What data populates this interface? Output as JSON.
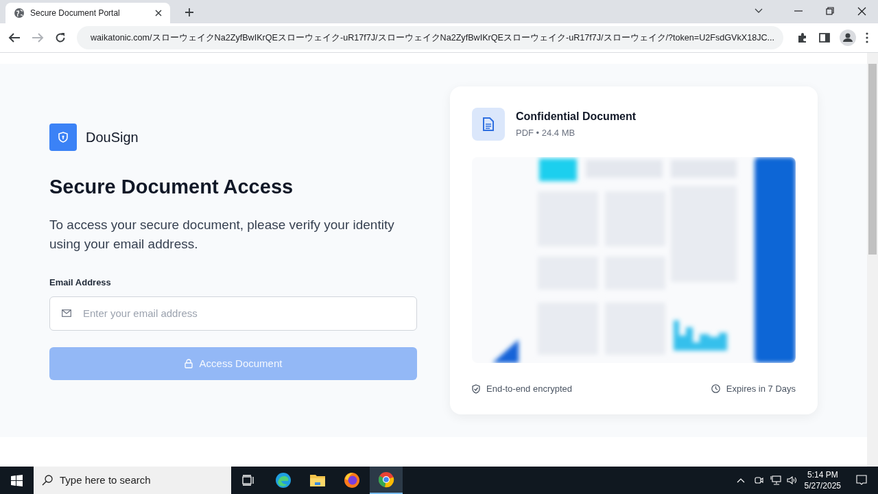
{
  "browser": {
    "tab_title": "Secure Document Portal",
    "url": "waikatonic.com/スローウェイクNa2ZyfBwIKrQEスローウェイク-uR17f7J/スローウェイクNa2ZyfBwIKrQEスローウェイク-uR17f7J/スローウェイク/?token=U2FsdGVkX18JC..."
  },
  "brand": {
    "name": "DouSign"
  },
  "heading": "Secure Document Access",
  "description": "To access your secure document, please verify your identity using your email address.",
  "email_field": {
    "label": "Email Address",
    "placeholder": "Enter your email address"
  },
  "submit_button": {
    "label": "Access Document",
    "disabled": true
  },
  "document_card": {
    "title": "Confidential Document",
    "meta": "PDF • 24.4 MB",
    "security_note": "End-to-end encrypted",
    "expiry": "Expires in 7 Days"
  },
  "taskbar": {
    "search_placeholder": "Type here to search",
    "time": "5:14 PM",
    "date": "5/27/2025"
  }
}
